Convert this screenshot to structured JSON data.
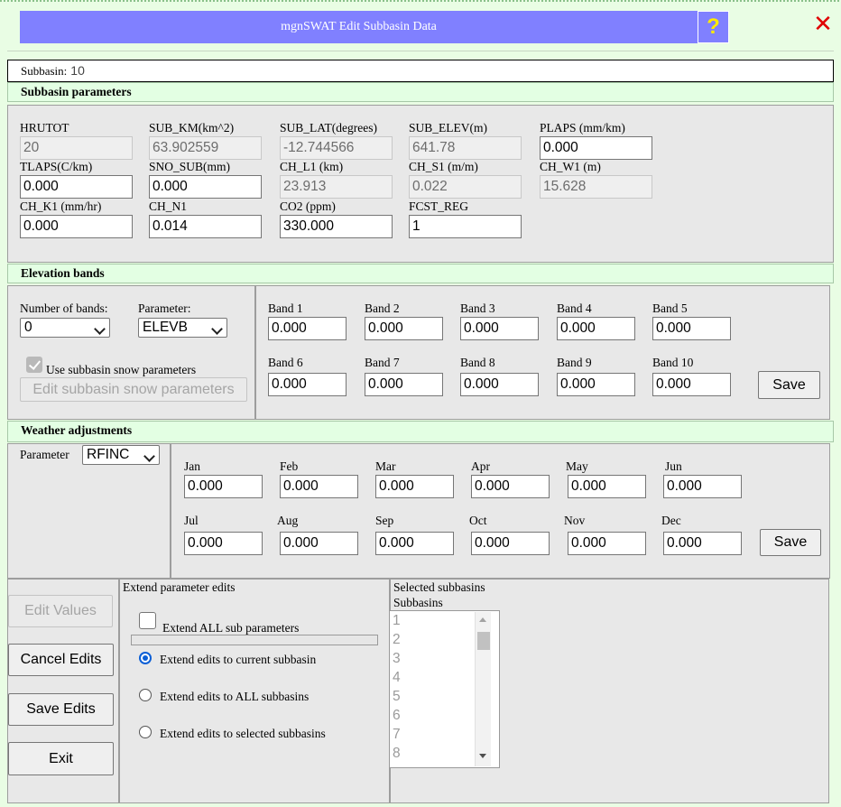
{
  "window": {
    "title": "mgnSWAT Edit Subbasin Data",
    "help_label": "?",
    "close_label": "✕"
  },
  "subbasin": {
    "label": "Subbasin:",
    "value": "10"
  },
  "subbasin_params": {
    "heading": "Subbasin parameters",
    "fields": [
      {
        "label": "HRUTOT",
        "value": "20",
        "readonly": true
      },
      {
        "label": "SUB_KM(km^2)",
        "value": "63.902559",
        "readonly": true
      },
      {
        "label": "SUB_LAT(degrees)",
        "value": "-12.744566",
        "readonly": true
      },
      {
        "label": "SUB_ELEV(m)",
        "value": "641.78",
        "readonly": true
      },
      {
        "label": "PLAPS (mm/km)",
        "value": "0.000",
        "readonly": false
      },
      {
        "label": "TLAPS(C/km)",
        "value": "0.000",
        "readonly": false
      },
      {
        "label": "SNO_SUB(mm)",
        "value": "0.000",
        "readonly": false
      },
      {
        "label": "CH_L1 (km)",
        "value": "23.913",
        "readonly": true
      },
      {
        "label": "CH_S1 (m/m)",
        "value": "0.022",
        "readonly": true
      },
      {
        "label": "CH_W1 (m)",
        "value": "15.628",
        "readonly": true
      },
      {
        "label": "CH_K1 (mm/hr)",
        "value": "0.000",
        "readonly": false
      },
      {
        "label": "CH_N1",
        "value": "0.014",
        "readonly": false
      },
      {
        "label": "CO2 (ppm)",
        "value": "330.000",
        "readonly": false
      },
      {
        "label": "FCST_REG",
        "value": "1",
        "readonly": false
      }
    ]
  },
  "elevation": {
    "heading": "Elevation bands",
    "num_bands_label": "Number of bands:",
    "num_bands_value": "0",
    "parameter_label": "Parameter:",
    "parameter_value": "ELEVB",
    "snow_checkbox_label": "Use subbasin snow parameters",
    "snow_checked": true,
    "edit_snow_label": "Edit subbasin snow parameters",
    "save_label": "Save",
    "bands": [
      {
        "label": "Band 1",
        "value": "0.000"
      },
      {
        "label": "Band 2",
        "value": "0.000"
      },
      {
        "label": "Band 3",
        "value": "0.000"
      },
      {
        "label": "Band 4",
        "value": "0.000"
      },
      {
        "label": "Band 5",
        "value": "0.000"
      },
      {
        "label": "Band 6",
        "value": "0.000"
      },
      {
        "label": "Band 7",
        "value": "0.000"
      },
      {
        "label": "Band 8",
        "value": "0.000"
      },
      {
        "label": "Band 9",
        "value": "0.000"
      },
      {
        "label": "Band 10",
        "value": "0.000"
      }
    ]
  },
  "weather": {
    "heading": "Weather adjustments",
    "parameter_label": "Parameter",
    "parameter_value": "RFINC",
    "save_label": "Save",
    "months": [
      {
        "label": "Jan",
        "value": "0.000"
      },
      {
        "label": "Feb",
        "value": "0.000"
      },
      {
        "label": "Mar",
        "value": "0.000"
      },
      {
        "label": "Apr",
        "value": "0.000"
      },
      {
        "label": "May",
        "value": "0.000"
      },
      {
        "label": "Jun",
        "value": "0.000"
      },
      {
        "label": "Jul",
        "value": "0.000"
      },
      {
        "label": "Aug",
        "value": "0.000"
      },
      {
        "label": "Sep",
        "value": "0.000"
      },
      {
        "label": "Oct",
        "value": "0.000"
      },
      {
        "label": "Nov",
        "value": "0.000"
      },
      {
        "label": "Dec",
        "value": "0.000"
      }
    ]
  },
  "actions": {
    "edit_values": "Edit Values",
    "cancel_edits": "Cancel Edits",
    "save_edits": "Save Edits",
    "exit": "Exit"
  },
  "extend": {
    "heading": "Extend parameter edits",
    "all_sub_label": "Extend ALL sub parameters",
    "all_sub_checked": false,
    "options": [
      {
        "label": "Extend edits to current subbasin",
        "selected": true
      },
      {
        "label": "Extend edits to ALL subbasins",
        "selected": false
      },
      {
        "label": "Extend edits to selected subbasins",
        "selected": false
      }
    ]
  },
  "selected": {
    "heading": "Selected subbasins",
    "list_label": "Subbasins",
    "items": [
      "1",
      "2",
      "3",
      "4",
      "5",
      "6",
      "7",
      "8"
    ]
  }
}
